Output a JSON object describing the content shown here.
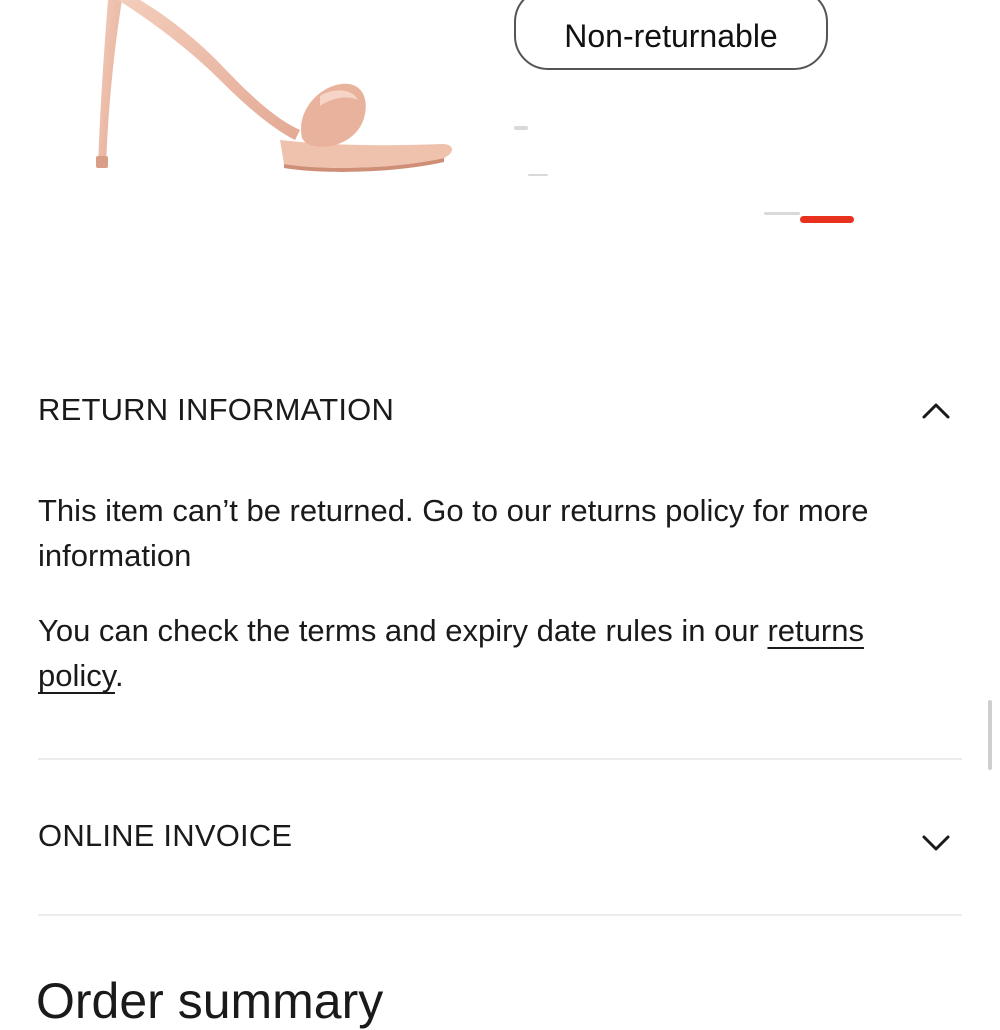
{
  "product": {
    "image": "nude-leather-heeled-sandal",
    "status_label": "Non-returnable"
  },
  "return_information": {
    "title": "RETURN INFORMATION",
    "expanded": true,
    "chevron_icon": "chevron-up-icon",
    "text_1": "This item can’t be returned. Go to our returns policy for more information",
    "text_2_prefix": "You can check the terms and expiry date rules in our ",
    "policy_link": "returns policy",
    "text_2_suffix": "."
  },
  "online_invoice": {
    "title": "ONLINE INVOICE",
    "expanded": false,
    "chevron_icon": "chevron-down-icon"
  },
  "order_summary": {
    "title": "Order summary"
  },
  "colors": {
    "text": "#1a1a1a",
    "divider": "#ececec",
    "pill_border": "#555555",
    "accent": "#e8321e"
  }
}
